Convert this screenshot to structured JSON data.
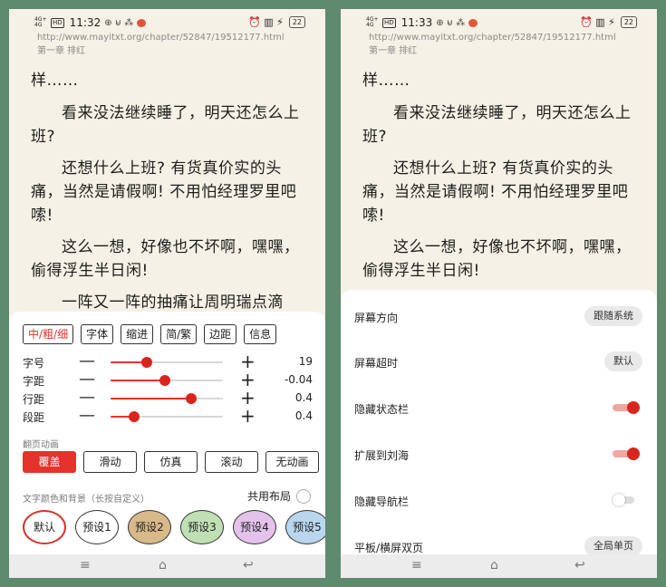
{
  "status": {
    "signal": "4G+ 4G",
    "hd": "HD",
    "time_left": "11:32",
    "time_right": "11:33",
    "extra_icons": "⊕ ⊌ ⁂",
    "right_icons": "⏰ ▥ ⚡",
    "battery": "22"
  },
  "reader": {
    "url": "http://www.mayitxt.org/chapter/52847/19512177.html",
    "chapter": "第一章 排红",
    "paragraphs": [
      "样……",
      "看来没法继续睡了，明天还怎么上班?",
      "还想什么上班? 有货真价实的头痛，当然是请假啊! 不用怕经理罗里吧嗦!",
      "这么一想，好像也不坏啊，嘿嘿，偷得浮生半日闲!",
      "一阵又一阵的抽痛让周明瑞点滴"
    ]
  },
  "left_panel": {
    "font_tabs": [
      "中/粗/细",
      "字体",
      "缩进",
      "简/繁",
      "边距",
      "信息"
    ],
    "sliders": [
      {
        "label": "字号",
        "value": "19",
        "level": 0.32
      },
      {
        "label": "字距",
        "value": "-0.04",
        "level": 0.48
      },
      {
        "label": "行距",
        "value": "0.4",
        "level": 0.72
      },
      {
        "label": "段距",
        "value": "0.4",
        "level": 0.21
      }
    ],
    "minus": "—",
    "plus": "+",
    "animation_title": "翻页动画",
    "animations": [
      "覆盖",
      "滑动",
      "仿真",
      "滚动",
      "无动画"
    ],
    "color_title": "文字颜色和背景（长按自定义）",
    "shared_layout": "共用布局",
    "themes": [
      {
        "label": "默认",
        "color": "#ffffff"
      },
      {
        "label": "预设1",
        "color": "#ffffff"
      },
      {
        "label": "预设2",
        "color": "#d8b98a"
      },
      {
        "label": "预设3",
        "color": "#bfe0b4"
      },
      {
        "label": "预设4",
        "color": "#e4c2ec"
      },
      {
        "label": "预设5",
        "color": "#b9d6ee"
      }
    ]
  },
  "right_panel": {
    "rows": [
      {
        "label": "屏幕方向",
        "type": "button",
        "value": "跟随系统"
      },
      {
        "label": "屏幕超时",
        "type": "button",
        "value": "默认"
      },
      {
        "label": "隐藏状态栏",
        "type": "toggle",
        "on": true
      },
      {
        "label": "扩展到刘海",
        "type": "toggle",
        "on": true
      },
      {
        "label": "隐藏导航栏",
        "type": "toggle",
        "on": false
      },
      {
        "label": "平板/横屏双页",
        "type": "button",
        "value": "全局单页"
      }
    ]
  },
  "nav": {
    "menu": "≡",
    "home": "⌂",
    "back": "↩"
  },
  "colors": {
    "accent": "#e5322b",
    "paper": "#f6f1e6",
    "background": "#5e8a6e"
  }
}
